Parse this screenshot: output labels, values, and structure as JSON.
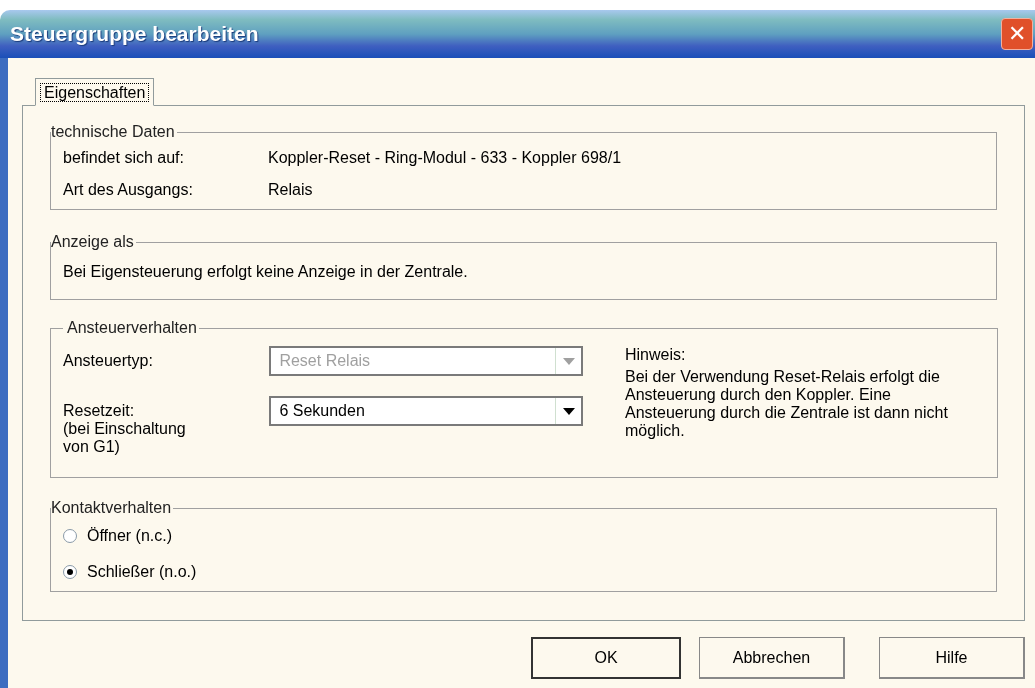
{
  "window": {
    "title": "Steuergruppe bearbeiten",
    "close": "✕"
  },
  "tabs": [
    {
      "label": "Eigenschaften",
      "selected": true
    }
  ],
  "technische_daten": {
    "title": "technische Daten",
    "rows": [
      {
        "label": "befindet sich auf:",
        "value": "Koppler-Reset - Ring-Modul - 633 - Koppler 698/1"
      },
      {
        "label": "Art des Ausgangs:",
        "value": "Relais"
      }
    ]
  },
  "anzeige_als": {
    "title": "Anzeige als",
    "text": "Bei Eigensteuerung erfolgt keine Anzeige in der Zentrale."
  },
  "ansteuerverhalten": {
    "title": "Ansteuerverhalten",
    "fields": [
      {
        "label": "Ansteuertyp:",
        "value": "Reset Relais",
        "disabled": true
      },
      {
        "label": "Resetzeit:\n(bei Einschaltung\nvon G1)",
        "value": "6 Sekunden",
        "disabled": false
      }
    ],
    "hint_title": "Hinweis:",
    "hint": "Bei der Verwendung Reset-Relais erfolgt die Ansteuerung durch den Koppler. Eine Ansteuerung durch die Zentrale ist dann nicht möglich."
  },
  "kontaktverhalten": {
    "title": "Kontaktverhalten",
    "options": [
      {
        "label": "Öffner (n.c.)",
        "selected": false
      },
      {
        "label": "Schließer (n.o.)",
        "selected": true
      }
    ]
  },
  "buttons": [
    {
      "label": "OK",
      "default": true
    },
    {
      "label": "Abbrechen",
      "default": false
    },
    {
      "label": "Hilfe",
      "default": false
    }
  ]
}
